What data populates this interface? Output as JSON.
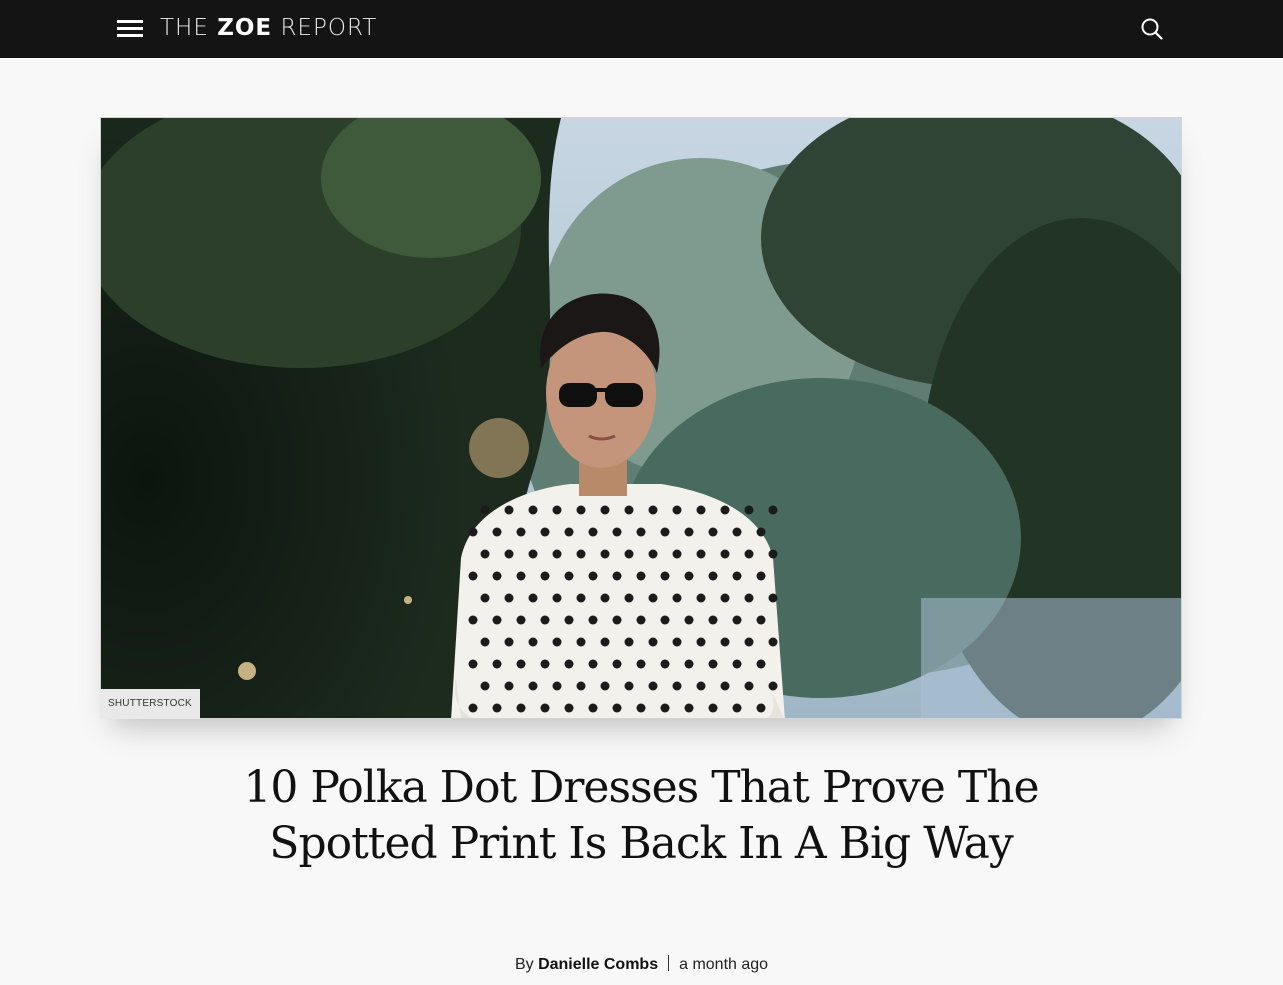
{
  "header": {
    "logo_part1": "THE ",
    "logo_part2": "ZOE",
    "logo_part3": " REPORT",
    "menu_icon": "hamburger-menu-icon",
    "search_icon": "search-icon"
  },
  "hero": {
    "credit": "SHUTTERSTOCK"
  },
  "article": {
    "title": "10 Polka Dot Dresses That Prove The Spotted Print Is Back In A Big Way",
    "byline_prefix": "By ",
    "author": "Danielle Combs",
    "published": "a month ago"
  },
  "colors": {
    "topbar": "#141414",
    "page_bg": "#f8f8f8",
    "text": "#111111"
  }
}
